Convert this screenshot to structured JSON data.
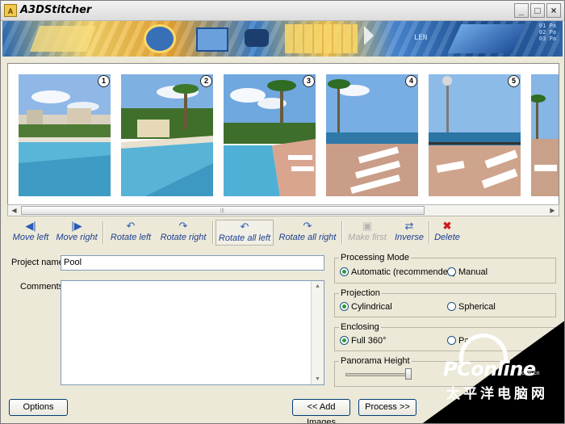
{
  "window": {
    "title": "A3DStitcher",
    "controls": {
      "minimize": "_",
      "maximize": "□",
      "close": "×"
    }
  },
  "banner": {
    "text_lines": [
      "01 Pa",
      "02 Pa",
      "03 Pa",
      "LEN"
    ]
  },
  "thumbnails": [
    {
      "number": "1"
    },
    {
      "number": "2"
    },
    {
      "number": "3"
    },
    {
      "number": "4"
    },
    {
      "number": "5"
    }
  ],
  "toolbar": {
    "move_left": "Move left",
    "move_right": "Move right",
    "rotate_left": "Rotate left",
    "rotate_right": "Rotate right",
    "rotate_all_left": "Rotate all left",
    "rotate_all_right": "Rotate all right",
    "make_first": "Make first",
    "inverse": "Inverse",
    "delete": "Delete"
  },
  "form": {
    "project_name_label": "Project name :",
    "project_name_value": "Pool",
    "comments_label": "Comments :",
    "comments_value": ""
  },
  "processing_mode": {
    "title": "Processing Mode",
    "automatic": "Automatic (recommended)",
    "manual": "Manual",
    "selected": "automatic"
  },
  "projection": {
    "title": "Projection",
    "cylindrical": "Cylindrical",
    "spherical": "Spherical",
    "selected": "cylindrical"
  },
  "enclosing": {
    "title": "Enclosing",
    "full": "Full 360°",
    "partial": "Pa",
    "selected": "full"
  },
  "panorama_height": {
    "title": "Panorama Height",
    "level": 0.95
  },
  "buttons": {
    "options": "Options",
    "add_images": "<< Add Images",
    "process": "Process >>"
  },
  "watermark": {
    "logo": "PConline",
    "domain": ".com.cn",
    "cn": "太平洋电脑网"
  }
}
